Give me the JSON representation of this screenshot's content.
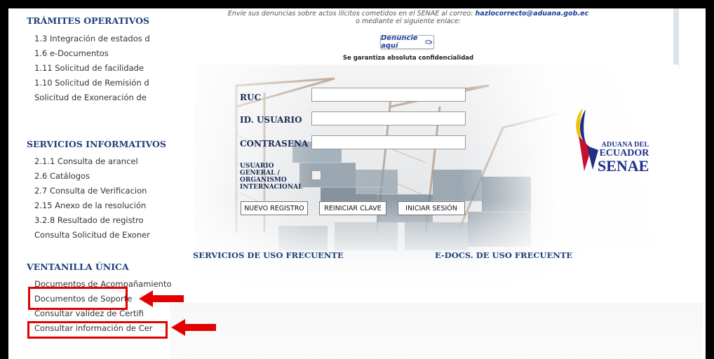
{
  "sidebar": {
    "tramites": {
      "title": "TRÁMITES OPERATIVOS",
      "items": [
        "1.3 Integración de estados d",
        "1.6 e-Documentos",
        "1.11 Solicitud de facilidade",
        "1.10 Solicitud de Remisión d",
        "Solicitud de Exoneración de"
      ]
    },
    "servicios": {
      "title": "SERVICIOS INFORMATIVOS",
      "items": [
        "2.1.1 Consulta de arancel",
        "2.6 Catálogos",
        "2.7 Consulta de Verificacion",
        "2.15 Anexo de la resolución",
        "3.2.8 Resultado de registro",
        "Consulta Solicitud de Exoner"
      ]
    },
    "ventanilla": {
      "title": "VENTANILLA ÚNICA",
      "items": [
        "Documentos de Acompañamiento",
        "Documentos de Soporte",
        "Consultar validez de Certifi",
        "Consultar información de Cer"
      ]
    }
  },
  "notice": {
    "line1_prefix": "Envíe sus denuncias sobre actos ilícitos cometidos en el SENAE al correo: ",
    "email": "hazlocorrecto@aduana.gob.ec",
    "line2": "o mediante el siguiente enlace:",
    "denuncie_label": "Denuncie aquí",
    "guarantee": "Se garantiza absoluta confidencialidad"
  },
  "login": {
    "ruc_label": "RUC",
    "ruc_value": "",
    "user_label": "ID. USUARIO",
    "user_value": "",
    "password_label": "CONTRASENA",
    "password_value": "",
    "general_user_label_lines": [
      "USUARIO",
      "GENERAL /",
      "ORGANISMO",
      "INTERNACIONAL"
    ],
    "general_user_checked": false,
    "btn_register": "NUEVO REGISTRO",
    "btn_reset": "REINICIAR CLAVE",
    "btn_login": "INICIAR SESIÓN"
  },
  "logo": {
    "line1": "ADUANA DEL",
    "line2": "ECUADOR",
    "line3": "SENAE"
  },
  "frequent": {
    "services": "SERVICIOS DE USO FRECUENTE",
    "edocs": "E-DOCS. DE USO FRECUENTE"
  },
  "colors": {
    "highlight": "#e30000",
    "heading": "#1f3f7a",
    "logo_blue": "#1d2f86",
    "logo_red": "#c8102e",
    "logo_yellow": "#f2c200"
  }
}
